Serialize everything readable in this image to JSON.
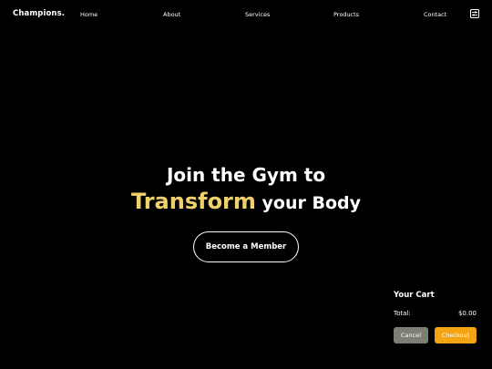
{
  "brand": {
    "logo": "Champions."
  },
  "nav": {
    "home": "Home",
    "about": "About",
    "services": "Services",
    "products": "Products",
    "contact": "Contact",
    "cart_icon": "sliders-icon"
  },
  "hero": {
    "line1": "Join the Gym to",
    "accent": "Transform",
    "rest": " your Body",
    "cta": "Become a Member"
  },
  "cart": {
    "title": "Your Cart",
    "total_label": "Total:",
    "total_value": "$0.00",
    "cancel": "Cancel",
    "checkout": "Checkout"
  },
  "colors": {
    "background": "#000000",
    "accent": "#f0d06a",
    "checkout": "#f5a414",
    "cancel": "#7c7f74"
  }
}
